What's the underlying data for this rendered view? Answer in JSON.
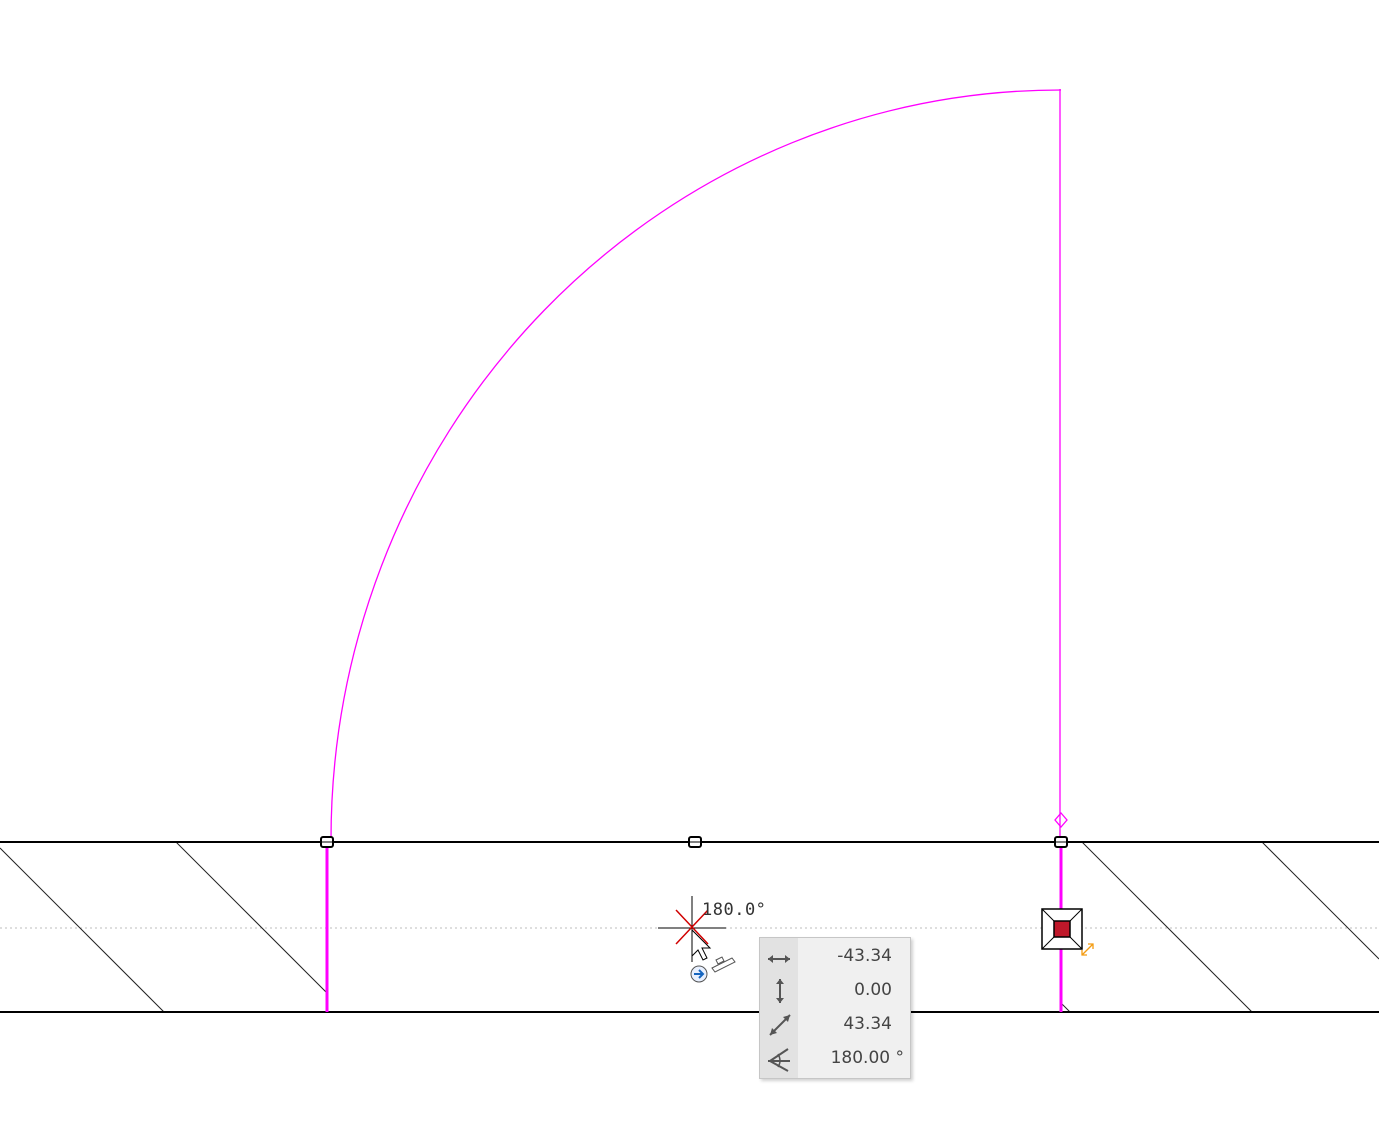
{
  "angle_readout": "180.0°",
  "coord_panel": {
    "dx": "-43.34",
    "dy": "0.00",
    "distance": "43.34",
    "angle": "180.00 °",
    "icons": [
      "horizontal-distance-icon",
      "vertical-distance-icon",
      "diagonal-distance-icon",
      "angle-icon"
    ]
  },
  "colors": {
    "door_symbol": "#ff00ff",
    "wall_line": "#000000",
    "cursor_red": "#d00000",
    "grip_fill": "#c0182a",
    "stretch_arrow": "#f39c12",
    "panel_bg": "#f0f0f0"
  }
}
